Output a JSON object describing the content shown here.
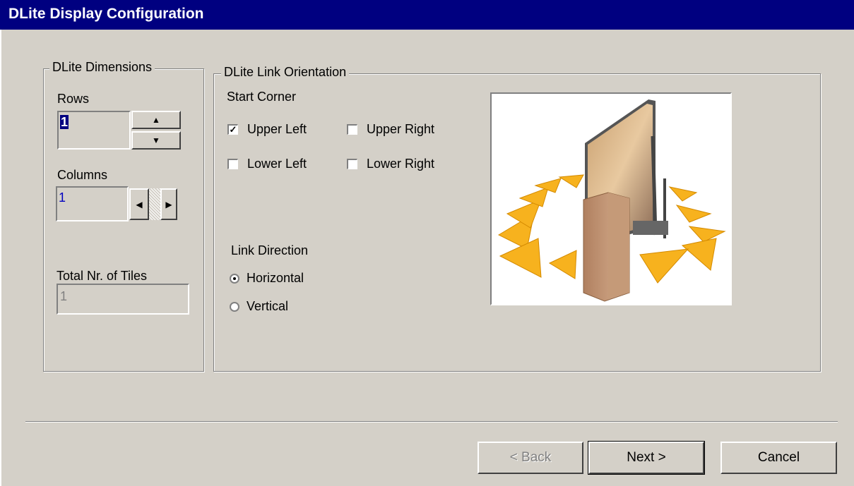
{
  "window": {
    "title": "DLite Display Configuration"
  },
  "dimensions": {
    "legend": "DLite Dimensions",
    "rows_label": "Rows",
    "rows_value": "1",
    "columns_label": "Columns",
    "columns_value": "1",
    "total_label": "Total Nr. of Tiles",
    "total_value": "1"
  },
  "orientation": {
    "legend": "DLite Link Orientation",
    "start_corner_label": "Start Corner",
    "corners": [
      {
        "label": "Upper Left",
        "checked": true
      },
      {
        "label": "Upper Right",
        "checked": false
      },
      {
        "label": "Lower Left",
        "checked": false
      },
      {
        "label": "Lower Right",
        "checked": false
      }
    ],
    "link_direction_label": "Link Direction",
    "directions": [
      {
        "label": "Horizontal",
        "selected": true
      },
      {
        "label": "Vertical",
        "selected": false
      }
    ]
  },
  "buttons": {
    "back": "< Back",
    "next": "Next >",
    "cancel": "Cancel"
  },
  "icons": {
    "up": "spin-up-icon",
    "down": "spin-down-icon",
    "left": "spin-left-icon",
    "right": "spin-right-icon"
  },
  "colors": {
    "title_bar": "#000080",
    "face": "#d4d0c8",
    "arrow": "#f7b21e"
  }
}
